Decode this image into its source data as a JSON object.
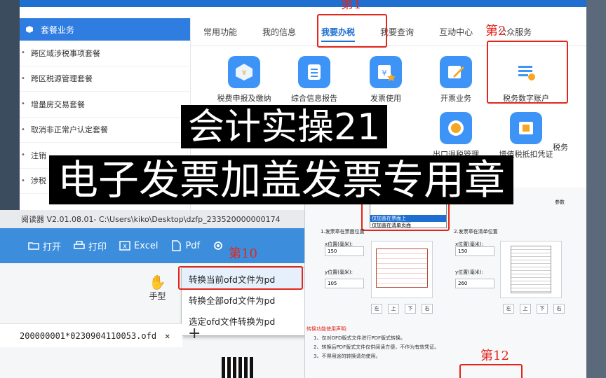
{
  "portal": {
    "side_header": "套餐业务",
    "side_items": [
      "跨区域涉税事项套餐",
      "跨区税源管理套餐",
      "增量房交易套餐",
      "取消非正常户认定套餐",
      "注销",
      "涉税"
    ],
    "tabs": [
      "常用功能",
      "我的信息",
      "我要办税",
      "我要查询",
      "互动中心",
      "公众服务"
    ],
    "active_tab": "我要办税",
    "functions_row1": [
      "税费申报及缴纳",
      "综合信息报告",
      "发票使用",
      "开票业务",
      "税务数字账户"
    ],
    "functions_row2": [
      "出口退税管理",
      "增值税抵扣凭证",
      "税务"
    ],
    "colors": {
      "brand": "#1e6fd0",
      "annotation": "#e4251a"
    }
  },
  "annotations": {
    "step1": "第1",
    "step2": "第2",
    "step10": "第10",
    "step12": "第12"
  },
  "overlay": {
    "line1": "会计实操21",
    "line2": "电子发票加盖发票专用章"
  },
  "reader": {
    "title": "阅读器 V2.01.08.01- C:\\Users\\kiko\\Desktop\\dzfp_233520000000174",
    "toolbar": {
      "open": "打开",
      "print": "打印",
      "excel": "Excel",
      "pdf": "Pdf"
    },
    "hand_label": "手型",
    "context_menu": [
      "转换当前ofd文件为pd",
      "转换全部ofd文件为pd",
      "选定ofd文件转换为pd"
    ],
    "file_tab": "200000001*0230904110053.ofd",
    "close_glyph": "✕",
    "plus_glyph": "+"
  },
  "dialog": {
    "params_label": "参数",
    "dropdown": [
      "仅加盖在票面上",
      "仅加盖在清单页面"
    ],
    "section1": "1.发票章在票面位置",
    "section2": "2.发票章在清单位置",
    "x_label": "x位置(毫米):",
    "y_label": "y位置(毫米):",
    "x1": "150",
    "y1": "105",
    "x2": "150",
    "y2": "260",
    "dir_buttons": [
      "左",
      "上",
      "下",
      "右"
    ],
    "notes_head": "转换功能使用声明:",
    "notes": [
      "1、仅对OFD版式文件进行PDF版式转换。",
      "2、转换后PDF版式文件仅供阅读方便，不作为有效凭证。",
      "3、不得用途的转换请勿使用。"
    ]
  }
}
